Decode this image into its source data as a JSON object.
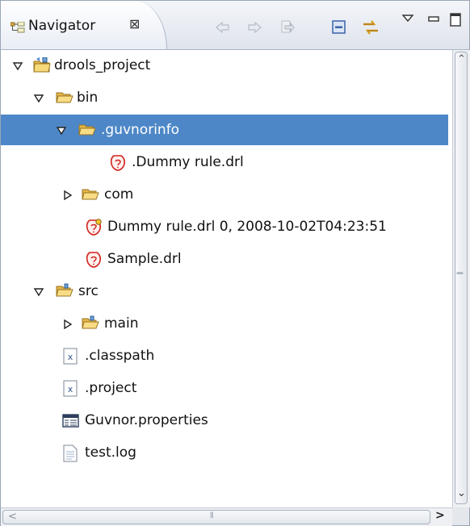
{
  "view": {
    "title": "Navigator",
    "close_glyph": "⊠",
    "toolbar": [
      {
        "name": "back-icon"
      },
      {
        "name": "forward-icon"
      },
      {
        "name": "go-into-icon"
      },
      {
        "name": "collapse-all-icon"
      },
      {
        "name": "link-with-editor-icon"
      },
      {
        "name": "view-menu-icon"
      },
      {
        "name": "minimize-icon"
      },
      {
        "name": "maximize-icon"
      }
    ]
  },
  "tree": [
    {
      "label": "drools_project",
      "icon": "project-icon",
      "twisty": "expanded"
    },
    {
      "label": "bin",
      "icon": "folder-open-icon",
      "twisty": "expanded"
    },
    {
      "label": ".guvnorinfo",
      "icon": "folder-open-icon",
      "twisty": "expanded",
      "selected": true
    },
    {
      "label": ".Dummy rule.drl",
      "icon": "drl-file-icon",
      "twisty": "none"
    },
    {
      "label": "com",
      "icon": "folder-icon",
      "twisty": "collapsed"
    },
    {
      "label": "Dummy rule.drl 0, 2008-10-02T04:23:51",
      "icon": "drl-file-versioned-icon",
      "twisty": "none"
    },
    {
      "label": "Sample.drl",
      "icon": "drl-file-icon",
      "twisty": "none"
    },
    {
      "label": "src",
      "icon": "source-folder-icon",
      "twisty": "expanded"
    },
    {
      "label": "main",
      "icon": "source-folder-icon",
      "twisty": "collapsed"
    },
    {
      "label": ".classpath",
      "icon": "xml-file-icon",
      "twisty": "none"
    },
    {
      "label": ".project",
      "icon": "xml-file-icon",
      "twisty": "none"
    },
    {
      "label": "Guvnor.properties",
      "icon": "properties-file-icon",
      "twisty": "none"
    },
    {
      "label": "test.log",
      "icon": "text-file-icon",
      "twisty": "none"
    }
  ],
  "scrollbars": {
    "up_arrow": "⌃",
    "down_arrow": "⌄",
    "left_arrow": "<",
    "right_arrow": ">",
    "grip": "⦀"
  }
}
